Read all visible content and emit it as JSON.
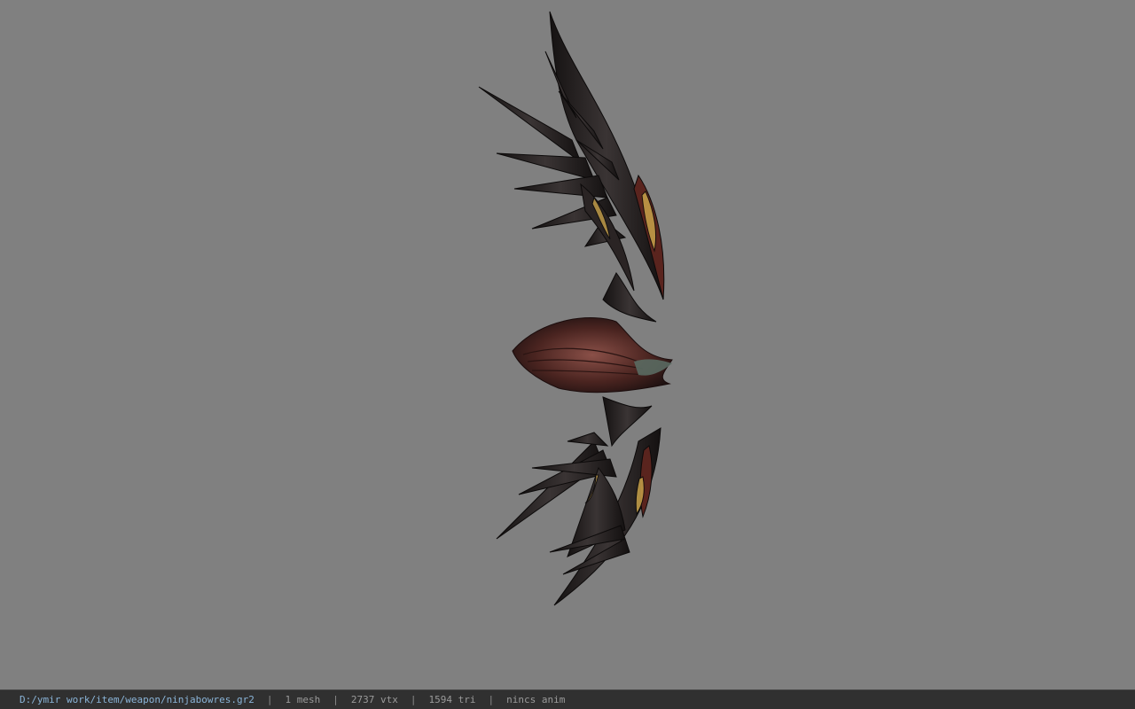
{
  "viewport": {
    "background_color": "#808080",
    "model_name": "bow-model"
  },
  "statusbar": {
    "file_path": "D:/ymir work/item/weapon/ninjabowres.gr2",
    "separator": "|",
    "mesh_count": "1 mesh",
    "vertex_count": "2737 vtx",
    "triangle_count": "1594 tri",
    "animation": "nincs anim"
  },
  "colors": {
    "statusbar_bg": "#303030",
    "path_text": "#8ab4d8",
    "info_text": "#9a9a9a",
    "model_dark": "#1e1a1a",
    "model_accent": "#6a2a22",
    "model_gold": "#c8a24a"
  }
}
